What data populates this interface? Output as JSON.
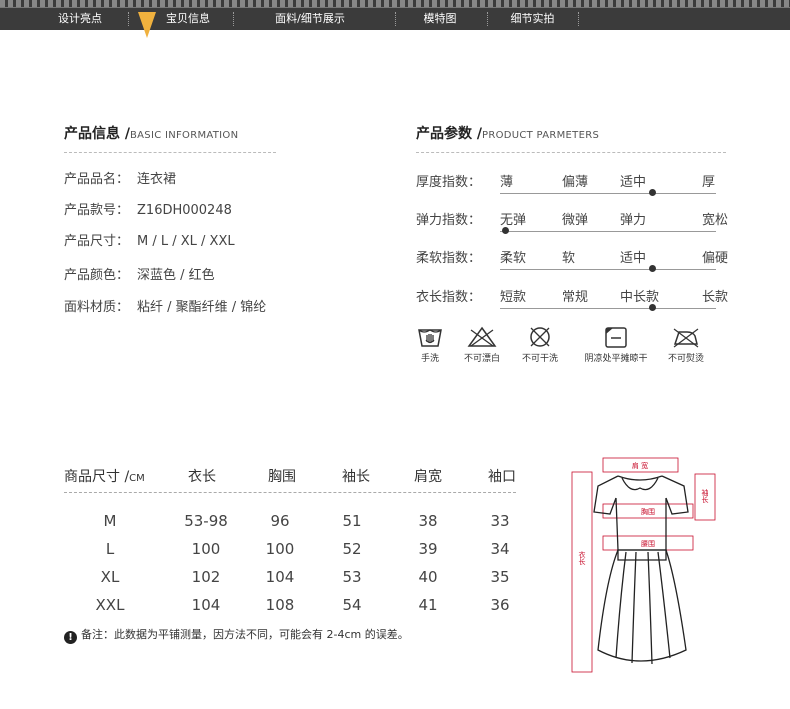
{
  "nav": {
    "tabs": [
      "设计亮点",
      "宝贝信息",
      "面料/细节展示",
      "模特图",
      "细节实拍"
    ],
    "active_index": 1,
    "active_color": "#f0b13e"
  },
  "product_info": {
    "title": "产品信息 /",
    "subtitle": "BASIC INFORMATION",
    "rows": [
      {
        "label": "产品品名：",
        "value": "连衣裙"
      },
      {
        "label": "产品款号：",
        "value": "Z16DH000248"
      },
      {
        "label": "产品尺寸：",
        "value": "M / L / XL / XXL"
      },
      {
        "label": "产品颜色：",
        "value": "深蓝色 / 红色"
      },
      {
        "label": "面料材质：",
        "value": "粘纤 / 聚酯纤维 / 锦纶"
      }
    ]
  },
  "product_params": {
    "title": "产品参数 /",
    "subtitle": "PRODUCT PARMETERS",
    "rows": [
      {
        "label": "厚度指数：",
        "options": [
          "薄",
          "偏薄",
          "适中",
          "厚"
        ],
        "selected_index": 2
      },
      {
        "label": "弹力指数：",
        "options": [
          "无弹",
          "微弹",
          "弹力",
          "宽松"
        ],
        "selected_index": 0
      },
      {
        "label": "柔软指数：",
        "options": [
          "柔软",
          "软",
          "适中",
          "偏硬"
        ],
        "selected_index": 2
      },
      {
        "label": "衣长指数：",
        "options": [
          "短款",
          "常规",
          "中长款",
          "长款"
        ],
        "selected_index": 2
      }
    ]
  },
  "care": [
    {
      "icon": "hand-wash-icon",
      "label": "手洗"
    },
    {
      "icon": "no-bleach-icon",
      "label": "不可漂白"
    },
    {
      "icon": "no-dry-clean-icon",
      "label": "不可干洗"
    },
    {
      "icon": "shade-flat-dry-icon",
      "label": "阴凉处平摊晾干"
    },
    {
      "icon": "no-iron-icon",
      "label": "不可熨烫"
    }
  ],
  "size_table": {
    "header_label": "商品尺寸 /",
    "header_unit": "CM",
    "columns": [
      "衣长",
      "胸围",
      "袖长",
      "肩宽",
      "袖口"
    ],
    "rows": [
      {
        "size": "M",
        "values": [
          "53-98",
          "96",
          "51",
          "38",
          "33"
        ]
      },
      {
        "size": "L",
        "values": [
          "100",
          "100",
          "52",
          "39",
          "34"
        ]
      },
      {
        "size": "XL",
        "values": [
          "102",
          "104",
          "53",
          "40",
          "35"
        ]
      },
      {
        "size": "XXL",
        "values": [
          "104",
          "108",
          "54",
          "41",
          "36"
        ]
      }
    ]
  },
  "note": {
    "icon": "warning-icon",
    "mark": "!",
    "text": "备注：此数据为平铺测量，因方法不同，可能会有 2-4cm 的误差。"
  },
  "diagram": {
    "labels": {
      "shoulder": "肩 宽",
      "sleeve": "袖长",
      "chest": "胸围",
      "waist": "腰围",
      "length": "衣长"
    },
    "accent_color": "#c8102e"
  }
}
